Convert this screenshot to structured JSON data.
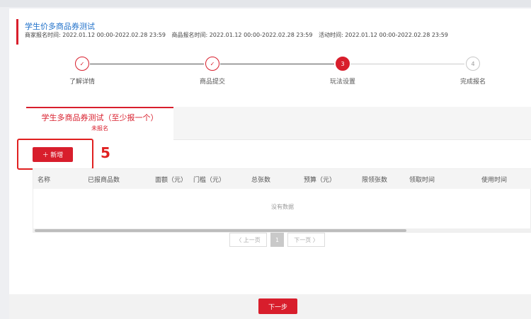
{
  "header": {
    "title": "学生价多商品券测试",
    "merchant_time": "商家报名时间:  2022.01.12 00:00-2022.02.28 23:59",
    "product_time": "商品报名时间:  2022.01.12 00:00-2022.02.28 23:59",
    "activity_time": "活动时间:  2022.01.12 00:00-2022.02.28 23:59"
  },
  "steps": [
    {
      "label": "了解详情",
      "marker": "✓",
      "state": "done"
    },
    {
      "label": "商品提交",
      "marker": "✓",
      "state": "done"
    },
    {
      "label": "玩法设置",
      "marker": "3",
      "state": "active"
    },
    {
      "label": "完成报名",
      "marker": "4",
      "state": "todo"
    }
  ],
  "tab": {
    "name": "学生多商品券测试（至少报一个）",
    "status": "未报名"
  },
  "add_button": "＋ 新增",
  "annotation": "5",
  "table": {
    "columns": [
      "名称",
      "已报商品数",
      "面额（元）",
      "门槛（元）",
      "总张数",
      "预算（元）",
      "限领张数",
      "领取时间",
      "使用时间"
    ],
    "empty_text": "没有数据"
  },
  "pagination": {
    "prev": "〈 上一页",
    "current": "1",
    "next": "下一页 〉"
  },
  "footer": {
    "next_button": "下一步"
  },
  "colors": {
    "accent": "#d81e2c",
    "title_blue": "#1e6fc9",
    "annotation_red": "#e02020"
  }
}
